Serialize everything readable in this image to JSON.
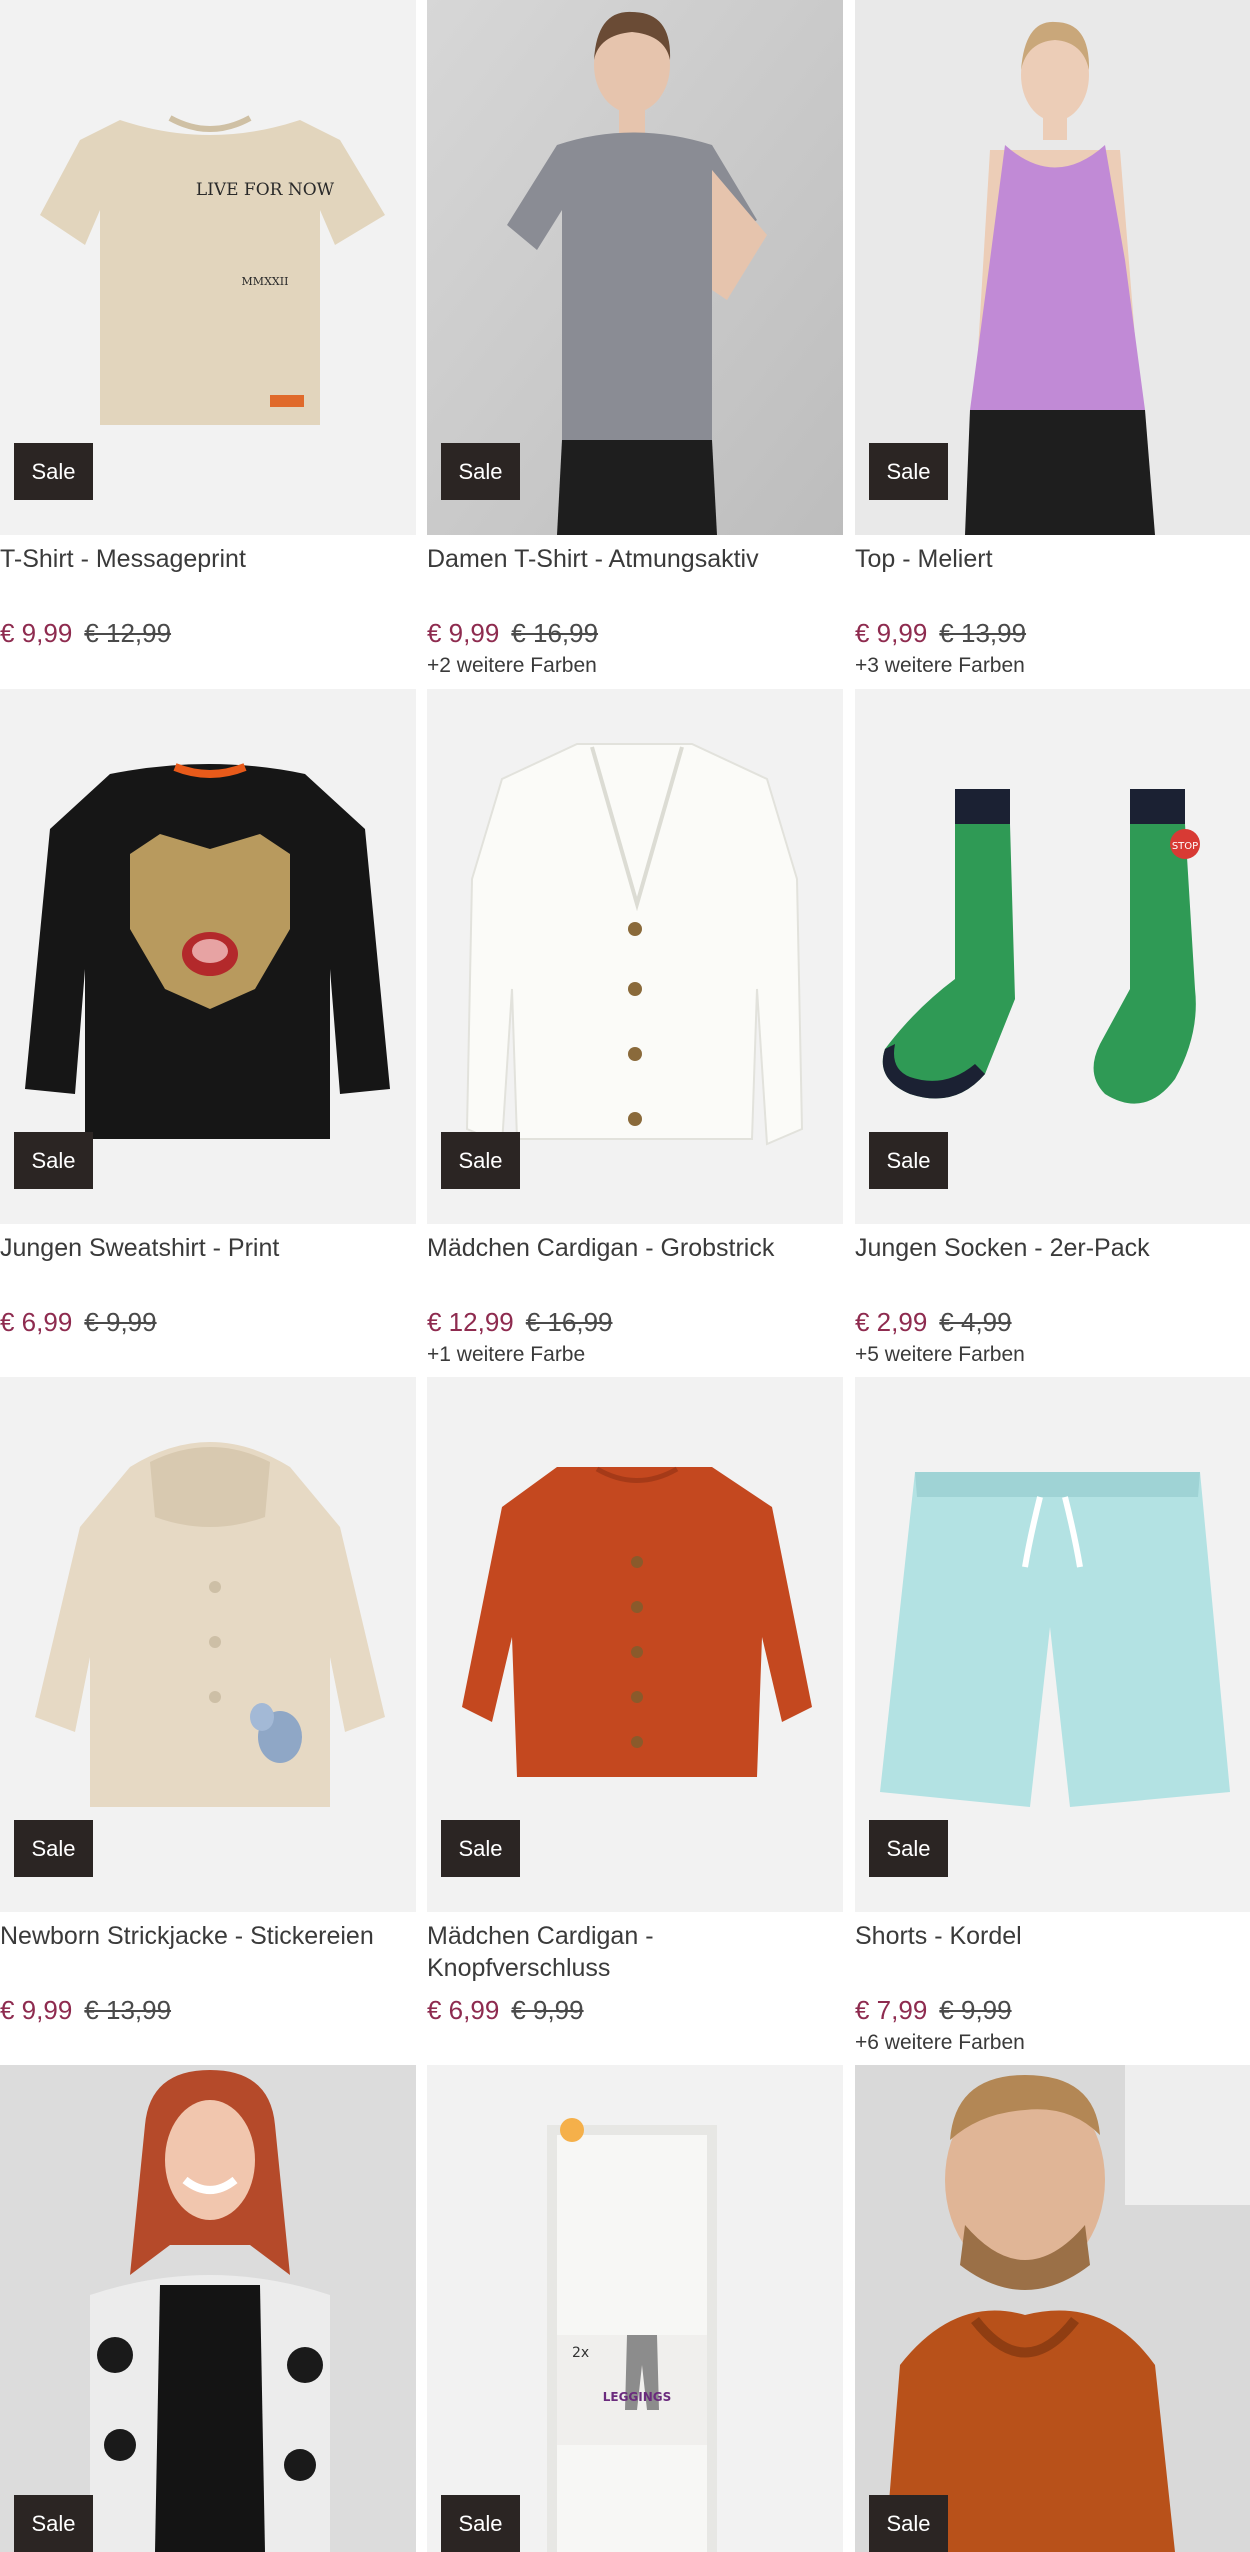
{
  "products": [
    {
      "title": "T-Shirt - Messageprint",
      "badge": "Sale",
      "price": "€ 9,99",
      "old_price": "€ 12,99",
      "colors": "",
      "print_text": "LIVE FOR NOW",
      "print_sub": "MMXXII"
    },
    {
      "title": "Damen T-Shirt - Atmungsaktiv",
      "badge": "Sale",
      "price": "€ 9,99",
      "old_price": "€ 16,99",
      "colors": "+2 weitere Farben"
    },
    {
      "title": "Top - Meliert",
      "badge": "Sale",
      "price": "€ 9,99",
      "old_price": "€ 13,99",
      "colors": "+3 weitere Farben"
    },
    {
      "title": "Jungen Sweatshirt - Print",
      "badge": "Sale",
      "price": "€ 6,99",
      "old_price": "€ 9,99",
      "colors": ""
    },
    {
      "title": "Mädchen Cardigan - Grobstrick",
      "badge": "Sale",
      "price": "€ 12,99",
      "old_price": "€ 16,99",
      "colors": "+1 weitere Farbe"
    },
    {
      "title": "Jungen Socken - 2er-Pack",
      "badge": "Sale",
      "price": "€ 2,99",
      "old_price": "€ 4,99",
      "colors": "+5 weitere Farben",
      "sign_text": "STOP"
    },
    {
      "title": "Newborn Strickjacke - Stickereien",
      "badge": "Sale",
      "price": "€ 9,99",
      "old_price": "€ 13,99",
      "colors": ""
    },
    {
      "title": "Mädchen Cardigan - Knopfverschluss",
      "badge": "Sale",
      "price": "€ 6,99",
      "old_price": "€ 9,99",
      "colors": ""
    },
    {
      "title": "Shorts - Kordel",
      "badge": "Sale",
      "price": "€ 7,99",
      "old_price": "€ 9,99",
      "colors": "+6 weitere Farben"
    },
    {
      "title": "",
      "badge": "Sale",
      "price": "",
      "old_price": "",
      "colors": ""
    },
    {
      "title": "",
      "badge": "Sale",
      "price": "",
      "old_price": "",
      "colors": "",
      "pack_text": "LEGGINGS",
      "pack_count": "2x"
    },
    {
      "title": "",
      "badge": "Sale",
      "price": "",
      "old_price": "",
      "colors": ""
    }
  ],
  "colors": {
    "sale_price": "#8e2b4f",
    "badge_bg": "#2b2523",
    "image_bg": "#f2f2f2"
  }
}
